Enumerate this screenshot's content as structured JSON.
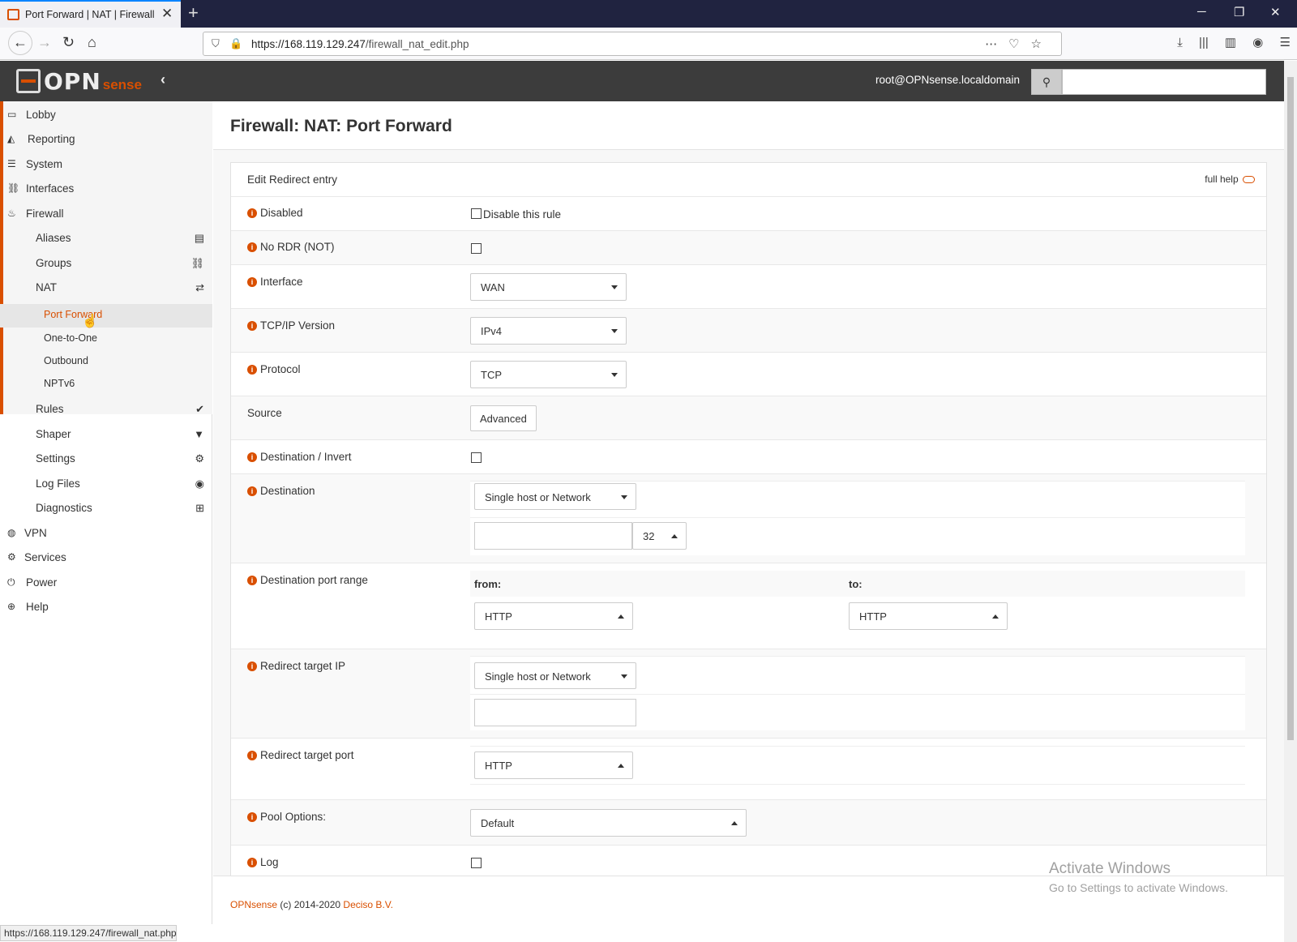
{
  "browser": {
    "tab_title": "Port Forward | NAT | Firewall | O",
    "url_host": "https://168.119.129.247",
    "url_path": "/firewall_nat_edit.php",
    "status_url": "https://168.119.129.247/firewall_nat.php"
  },
  "header": {
    "brand_opn": "OPN",
    "brand_sense": "sense",
    "user": "root@OPNsense.localdomain"
  },
  "sidebar": {
    "items": {
      "lobby": "Lobby",
      "reporting": "Reporting",
      "system": "System",
      "interfaces": "Interfaces",
      "firewall": "Firewall",
      "aliases": "Aliases",
      "groups": "Groups",
      "nat": "NAT",
      "port_forward": "Port Forward",
      "one_to_one": "One-to-One",
      "outbound": "Outbound",
      "nptv6": "NPTv6",
      "rules": "Rules",
      "shaper": "Shaper",
      "settings": "Settings",
      "log_files": "Log Files",
      "diagnostics": "Diagnostics",
      "vpn": "VPN",
      "services": "Services",
      "power": "Power",
      "help": "Help"
    }
  },
  "page": {
    "title": "Firewall: NAT: Port Forward",
    "panel_title": "Edit Redirect entry",
    "full_help": "full help"
  },
  "form": {
    "disabled": {
      "label": "Disabled",
      "checkbox_text": "Disable this rule"
    },
    "no_rdr": {
      "label": "No RDR (NOT)"
    },
    "interface": {
      "label": "Interface",
      "value": "WAN"
    },
    "ip_version": {
      "label": "TCP/IP Version",
      "value": "IPv4"
    },
    "protocol": {
      "label": "Protocol",
      "value": "TCP"
    },
    "source": {
      "label": "Source",
      "button": "Advanced"
    },
    "dest_invert": {
      "label": "Destination / Invert"
    },
    "destination": {
      "label": "Destination",
      "type": "Single host or Network",
      "mask": "32"
    },
    "dest_port_range": {
      "label": "Destination port range",
      "from_label": "from:",
      "to_label": "to:",
      "from": "HTTP",
      "to": "HTTP"
    },
    "redirect_ip": {
      "label": "Redirect target IP",
      "type": "Single host or Network"
    },
    "redirect_port": {
      "label": "Redirect target port",
      "value": "HTTP"
    },
    "pool_options": {
      "label": "Pool Options:",
      "value": "Default"
    },
    "log": {
      "label": "Log"
    }
  },
  "footer": {
    "brand": "OPNsense",
    "copyright": " (c) 2014-2020 ",
    "company": "Deciso B.V."
  },
  "watermark": {
    "line1": "Activate Windows",
    "line2": "Go to Settings to activate Windows."
  },
  "colors": {
    "accent": "#d94f00",
    "topbar": "#3c3c3c"
  }
}
